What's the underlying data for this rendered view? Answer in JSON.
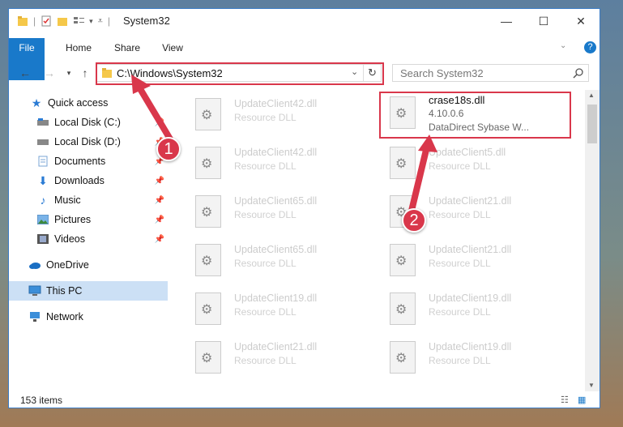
{
  "window": {
    "title": "System32",
    "controls": {
      "minimize": "—",
      "maximize": "☐",
      "close": "✕"
    }
  },
  "ribbon": {
    "tabs": [
      "File",
      "Home",
      "Share",
      "View"
    ],
    "help": "?"
  },
  "address": {
    "path": "C:\\Windows\\System32",
    "search_placeholder": "Search System32"
  },
  "nav": {
    "items": [
      {
        "label": "Quick access",
        "icon": "star-icon"
      },
      {
        "label": "Local Disk (C:)",
        "icon": "drive-icon"
      },
      {
        "label": "Local Disk (D:)",
        "icon": "drive-icon"
      },
      {
        "label": "Documents",
        "icon": "documents-icon"
      },
      {
        "label": "Downloads",
        "icon": "download-icon"
      },
      {
        "label": "Music",
        "icon": "music-icon"
      },
      {
        "label": "Pictures",
        "icon": "pictures-icon"
      },
      {
        "label": "Videos",
        "icon": "videos-icon"
      },
      {
        "label": "OneDrive",
        "icon": "cloud-icon"
      },
      {
        "label": "This PC",
        "icon": "computer-icon"
      },
      {
        "label": "Network",
        "icon": "network-icon"
      }
    ]
  },
  "files": {
    "left": [
      {
        "name": "UpdateClient42.dll",
        "desc": "Resource DLL"
      },
      {
        "name": "UpdateClient42.dll",
        "desc": "Resource DLL"
      },
      {
        "name": "UpdateClient65.dll",
        "desc": "Resource DLL"
      },
      {
        "name": "UpdateClient65.dll",
        "desc": "Resource DLL"
      },
      {
        "name": "UpdateClient19.dll",
        "desc": "Resource DLL"
      },
      {
        "name": "UpdateClient21.dll",
        "desc": "Resource DLL"
      }
    ],
    "right": [
      {
        "name": "crase18s.dll",
        "version": "4.10.0.6",
        "desc": "DataDirect Sybase W..."
      },
      {
        "name": "UpdateClient5.dll",
        "desc": "Resource DLL"
      },
      {
        "name": "UpdateClient21.dll",
        "desc": "Resource DLL"
      },
      {
        "name": "UpdateClient21.dll",
        "desc": "Resource DLL"
      },
      {
        "name": "UpdateClient19.dll",
        "desc": "Resource DLL"
      },
      {
        "name": "UpdateClient19.dll",
        "desc": "Resource DLL"
      }
    ]
  },
  "status": {
    "count": "153 items"
  },
  "annotations": {
    "badge1": "1",
    "badge2": "2",
    "color": "#d9374b"
  }
}
